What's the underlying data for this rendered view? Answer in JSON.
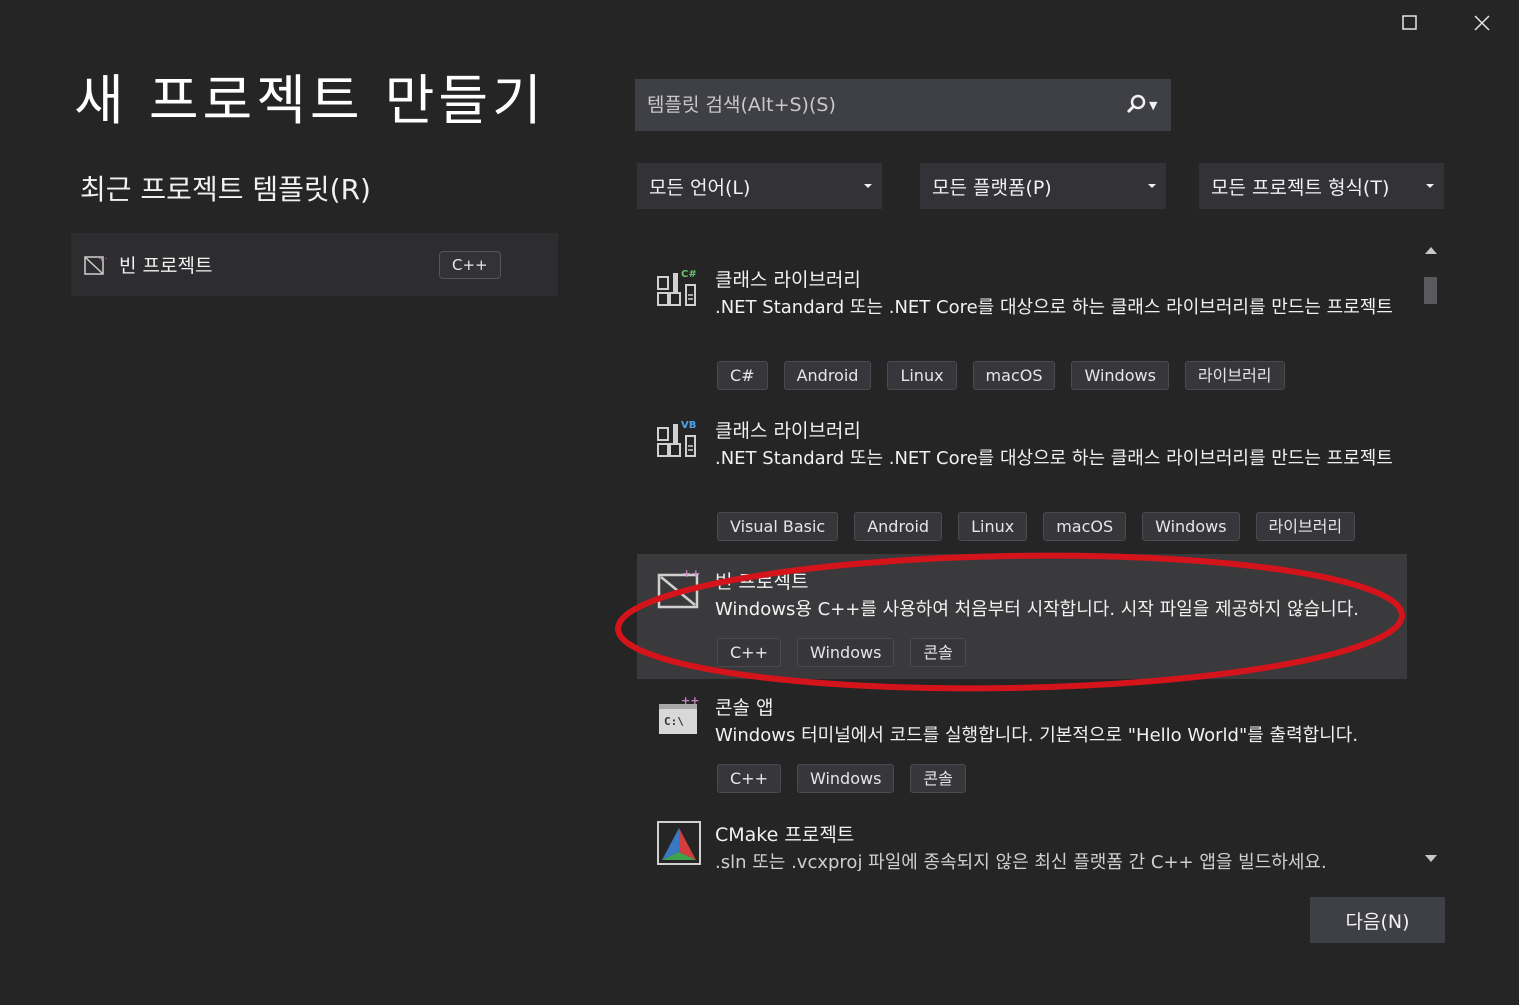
{
  "window": {
    "maximize_icon": "maximize-icon",
    "close_icon": "close-icon"
  },
  "page_title": "새 프로젝트 만들기",
  "recent": {
    "heading": "최근 프로젝트 템플릿(R)",
    "items": [
      {
        "name": "빈 프로젝트",
        "tag": "C++",
        "icon": "empty-project-icon"
      }
    ]
  },
  "search": {
    "placeholder": "템플릿 검색(Alt+S)(S)",
    "icon": "search-icon"
  },
  "filters": {
    "language": "모든 언어(L)",
    "platform": "모든 플랫폼(P)",
    "project_type": "모든 프로젝트 형식(T)"
  },
  "templates": [
    {
      "title": "클래스 라이브러리",
      "desc": ".NET Standard 또는 .NET Core를 대상으로 하는 클래스 라이브러리를 만드는 프로젝트",
      "badge": "C#",
      "tags": [
        "C#",
        "Android",
        "Linux",
        "macOS",
        "Windows",
        "라이브러리"
      ],
      "icon": "class-library-csharp-icon"
    },
    {
      "title": "클래스 라이브러리",
      "desc": ".NET Standard 또는 .NET Core를 대상으로 하는 클래스 라이브러리를 만드는 프로젝트",
      "badge": "VB",
      "tags": [
        "Visual Basic",
        "Android",
        "Linux",
        "macOS",
        "Windows",
        "라이브러리"
      ],
      "icon": "class-library-vb-icon"
    },
    {
      "title": "빈 프로젝트",
      "desc": "Windows용 C++를 사용하여 처음부터 시작합니다. 시작 파일을 제공하지 않습니다.",
      "tags": [
        "C++",
        "Windows",
        "콘솔"
      ],
      "icon": "empty-project-icon"
    },
    {
      "title": "콘솔 앱",
      "desc": "Windows 터미널에서 코드를 실행합니다. 기본적으로 \"Hello World\"를 출력합니다.",
      "tags": [
        "C++",
        "Windows",
        "콘솔"
      ],
      "icon": "console-app-icon"
    },
    {
      "title": "CMake 프로젝트",
      "desc": ".sln 또는 .vcxproj 파일에 종속되지 않은 최신 플랫폼 간 C++ 앱을 빌드하세요.",
      "icon": "cmake-icon"
    }
  ],
  "next_button": "다음(N)",
  "colors": {
    "highlight": "#d4141a",
    "background": "#252526",
    "selected_row": "#3a3a3d"
  }
}
